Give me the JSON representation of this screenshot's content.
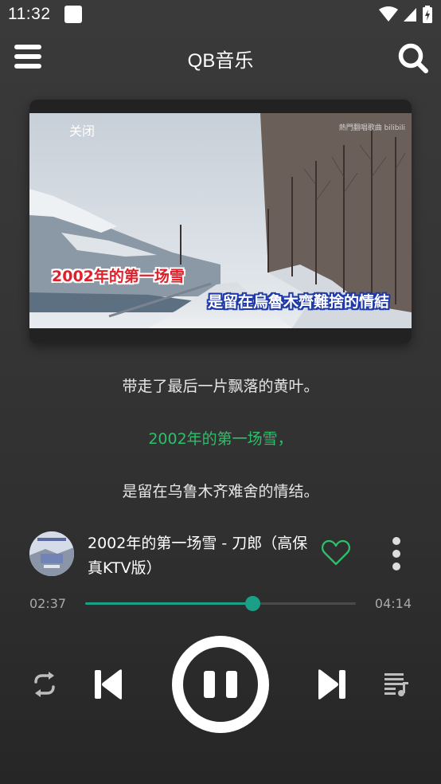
{
  "status_bar": {
    "time": "11:32"
  },
  "header": {
    "title": "QB音乐"
  },
  "video": {
    "close_label": "关闭",
    "watermark": "熱門翻唱歌曲 bilibili",
    "subtitle_line1": "2002年的第一场雪",
    "subtitle_line2": "是留在烏魯木齊難捨的情結"
  },
  "lyrics": {
    "previous": "带走了最后一片飘落的黄叶。",
    "current": "2002年的第一场雪，",
    "next": "是留在乌鲁木齐难舍的情结。"
  },
  "now_playing": {
    "title": "2002年的第一场雪 - 刀郎（高保真KTV版）",
    "liked": false
  },
  "progress": {
    "current_time": "02:37",
    "total_time": "04:14",
    "fraction": 0.618
  },
  "colors": {
    "accent_green": "#2dbf6a",
    "progress_teal": "#1aa087"
  },
  "icons": {
    "menu": "hamburger-menu-icon",
    "search": "search-icon",
    "like": "heart-outline-icon",
    "more": "more-vertical-icon",
    "repeat": "repeat-icon",
    "previous": "skip-previous-icon",
    "play_pause": "pause-icon",
    "next": "skip-next-icon",
    "playlist": "playlist-icon"
  }
}
